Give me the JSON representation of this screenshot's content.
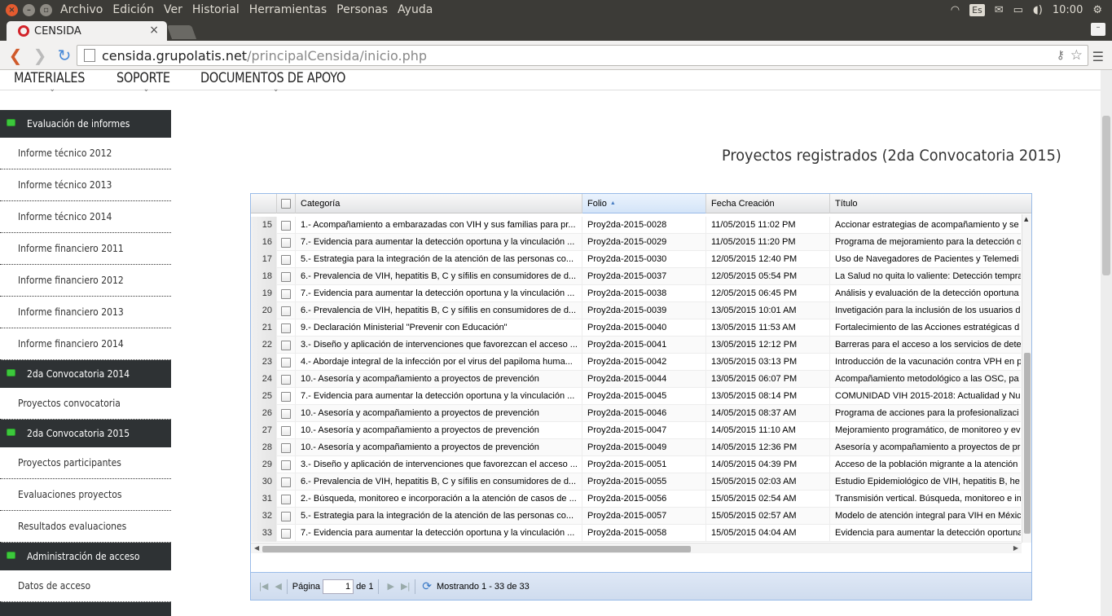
{
  "os": {
    "menus": [
      "Archivo",
      "Edición",
      "Ver",
      "Historial",
      "Herramientas",
      "Personas",
      "Ayuda"
    ],
    "keyboard": "Es",
    "clock": "10:00"
  },
  "browser": {
    "tab_title": "CENSIDA",
    "url_host": "censida.grupolatis.net",
    "url_path": "/principalCensida/inicio.php"
  },
  "nav": {
    "items": [
      "MATERIALES",
      "SOPORTE",
      "DOCUMENTOS DE APOYO"
    ]
  },
  "sidebar": {
    "sections": [
      {
        "title": "Evaluación de informes",
        "items": [
          "Informe técnico 2012",
          "Informe técnico 2013",
          "Informe técnico 2014",
          "Informe financiero 2011",
          "Informe financiero 2012",
          "Informe financiero 2013",
          "Informe financiero 2014"
        ]
      },
      {
        "title": "2da Convocatoria 2014",
        "items": [
          "Proyectos convocatoria"
        ]
      },
      {
        "title": "2da Convocatoria 2015",
        "items": [
          "Proyectos participantes",
          "Evaluaciones proyectos",
          "Resultados evaluaciones"
        ]
      },
      {
        "title": "Administración de acceso",
        "items": [
          "Datos de acceso"
        ]
      }
    ]
  },
  "page_title": "Proyectos registrados (2da Convocatoria 2015)",
  "grid": {
    "columns": [
      "Categoría",
      "Folio",
      "Fecha Creación",
      "Título"
    ],
    "rows": [
      {
        "n": "15",
        "cat": "1.- Acompañamiento a embarazadas con VIH y sus familias para pr...",
        "folio": "Proy2da-2015-0028",
        "fecha": "11/05/2015 11:02 PM",
        "titulo": "Accionar estrategias de acompañamiento y se"
      },
      {
        "n": "16",
        "cat": "7.- Evidencia para aumentar la detección oportuna y la vinculación ...",
        "folio": "Proy2da-2015-0029",
        "fecha": "11/05/2015 11:20 PM",
        "titulo": "Programa de mejoramiento para la detección o"
      },
      {
        "n": "17",
        "cat": "5.- Estrategia para la integración de la atención de las personas co...",
        "folio": "Proy2da-2015-0030",
        "fecha": "12/05/2015 12:40 PM",
        "titulo": "Uso de Navegadores de Pacientes y Telemedi"
      },
      {
        "n": "18",
        "cat": "6.- Prevalencia de VIH, hepatitis B, C y sífilis en consumidores de d...",
        "folio": "Proy2da-2015-0037",
        "fecha": "12/05/2015 05:54 PM",
        "titulo": "La Salud no quita lo valiente: Detección tempra"
      },
      {
        "n": "19",
        "cat": "7.- Evidencia para aumentar la detección oportuna y la vinculación ...",
        "folio": "Proy2da-2015-0038",
        "fecha": "12/05/2015 06:45 PM",
        "titulo": "Análisis y evaluación de la detección oportuna"
      },
      {
        "n": "20",
        "cat": "6.- Prevalencia de VIH, hepatitis B, C y sífilis en consumidores de d...",
        "folio": "Proy2da-2015-0039",
        "fecha": "13/05/2015 10:01 AM",
        "titulo": "Invetigación para la inclusión de los usuarios d"
      },
      {
        "n": "21",
        "cat": "9.- Declaración Ministerial \"Prevenir con Educación\"",
        "folio": "Proy2da-2015-0040",
        "fecha": "13/05/2015 11:53 AM",
        "titulo": "Fortalecimiento de las Acciones estratégicas d"
      },
      {
        "n": "22",
        "cat": "3.- Diseño y aplicación de intervenciones que favorezcan el acceso ...",
        "folio": "Proy2da-2015-0041",
        "fecha": "13/05/2015 12:12 PM",
        "titulo": "Barreras para el acceso a los servicios de dete"
      },
      {
        "n": "23",
        "cat": "4.- Abordaje integral de la infección por el virus del papiloma huma...",
        "folio": "Proy2da-2015-0042",
        "fecha": "13/05/2015 03:13 PM",
        "titulo": "Introducción de la vacunación contra VPH en p"
      },
      {
        "n": "24",
        "cat": "10.- Asesoría y acompañamiento a proyectos de prevención",
        "folio": "Proy2da-2015-0044",
        "fecha": "13/05/2015 06:07 PM",
        "titulo": "Acompañamiento metodológico a las OSC, pa"
      },
      {
        "n": "25",
        "cat": "7.- Evidencia para aumentar la detección oportuna y la vinculación ...",
        "folio": "Proy2da-2015-0045",
        "fecha": "13/05/2015 08:14 PM",
        "titulo": "COMUNIDAD VIH 2015-2018: Actualidad y Nu"
      },
      {
        "n": "26",
        "cat": "10.- Asesoría y acompañamiento a proyectos de prevención",
        "folio": "Proy2da-2015-0046",
        "fecha": "14/05/2015 08:37 AM",
        "titulo": "Programa de acciones para la profesionalizaci"
      },
      {
        "n": "27",
        "cat": "10.- Asesoría y acompañamiento a proyectos de prevención",
        "folio": "Proy2da-2015-0047",
        "fecha": "14/05/2015 11:10 AM",
        "titulo": "Mejoramiento programático, de monitoreo y ev"
      },
      {
        "n": "28",
        "cat": "10.- Asesoría y acompañamiento a proyectos de prevención",
        "folio": "Proy2da-2015-0049",
        "fecha": "14/05/2015 12:36 PM",
        "titulo": "Asesoría y acompañamiento a proyectos de pr"
      },
      {
        "n": "29",
        "cat": "3.- Diseño y aplicación de intervenciones que favorezcan el acceso ...",
        "folio": "Proy2da-2015-0051",
        "fecha": "14/05/2015 04:39 PM",
        "titulo": "Acceso de la población migrante a la atención"
      },
      {
        "n": "30",
        "cat": "6.- Prevalencia de VIH, hepatitis B, C y sífilis en consumidores de d...",
        "folio": "Proy2da-2015-0055",
        "fecha": "15/05/2015 02:03 AM",
        "titulo": "Estudio Epidemiológico de VIH, hepatitis B, he"
      },
      {
        "n": "31",
        "cat": "2.- Búsqueda, monitoreo e incorporación a la atención de casos de ...",
        "folio": "Proy2da-2015-0056",
        "fecha": "15/05/2015 02:54 AM",
        "titulo": "Transmisión vertical. Búsqueda, monitoreo e in"
      },
      {
        "n": "32",
        "cat": "5.- Estrategia para la integración de la atención de las personas co...",
        "folio": "Proy2da-2015-0057",
        "fecha": "15/05/2015 02:57 AM",
        "titulo": "Modelo de atención integral para VIH en Méxic"
      },
      {
        "n": "33",
        "cat": "7.- Evidencia para aumentar la detección oportuna y la vinculación ...",
        "folio": "Proy2da-2015-0058",
        "fecha": "15/05/2015 04:04 AM",
        "titulo": "Evidencia para aumentar la detección oportuna"
      }
    ]
  },
  "pager": {
    "page_label": "Página",
    "page_value": "1",
    "of_label": "de 1",
    "status": "Mostrando 1 - 33 de 33"
  }
}
